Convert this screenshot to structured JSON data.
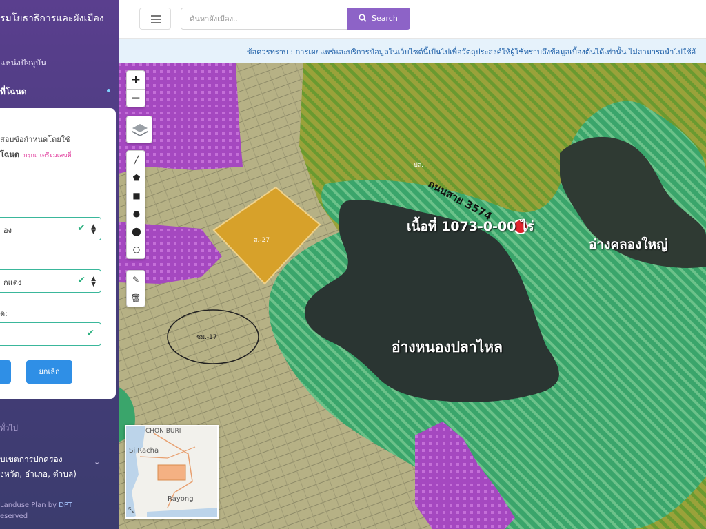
{
  "sidebar": {
    "title": "รมโยธาธิการและผังเมือง",
    "item_current": "แหน่งปัจจุบัน",
    "item_deed": "ที่โฉนด",
    "item_general": "ทั่วไป",
    "item_admin_line1": "บเขตการปกครอง",
    "item_admin_line2": "งหวัด, อำเภอ, ตำบล)",
    "footer_text": "Landuse Plan by",
    "footer_link": "DPT",
    "footer_rights": "eserved"
  },
  "form": {
    "hint": "สอบข้อกำหนดโดยใช้",
    "deed_label": "โฉนด",
    "deed_note": "กรุณาเตรียมเลขที่",
    "select1_value": "อง",
    "select2_value": "กแดง",
    "input_label": "ด:",
    "confirm_label": "",
    "cancel_label": "ยกเลิก"
  },
  "topbar": {
    "search_placeholder": "ค้นหาผังเมือง..",
    "search_label": "Search"
  },
  "notice": {
    "text": "ข้อควรทราบ : การเผยแพร่และบริการข้อมูลในเว็บไซต์นี้เป็นไปเพื่อวัตถุประสงค์ให้ผู้ใช้ทราบถึงข้อมูลเบื้องต้นได้เท่านั้น ไม่สามารถนำไปใช้อ้"
  },
  "map": {
    "road_label": "ถนนสาย 3574",
    "area_label": "เนื้อที่ 1073-0-00 ไร่",
    "reservoir_east": "อ่างคลองใหญ่",
    "reservoir_main": "อ่างหนองปลาไหล",
    "zone_small_1": "ชม.-17",
    "zone_small_2": "ส.-27",
    "zone_small_3": "ปล.",
    "zoom_in": "+",
    "zoom_out": "−",
    "colors": {
      "water": "#2a3532",
      "forest_buffer": "#3aa56b",
      "agri_hatch": "#9bbf3c",
      "residential": "#b24fc8",
      "industrial_orange": "#d7a12a",
      "marker_red": "#e0212b"
    }
  },
  "minimap": {
    "label_north": "CHON BURI",
    "label_city": "Si Racha",
    "label_south": "Rayong"
  }
}
